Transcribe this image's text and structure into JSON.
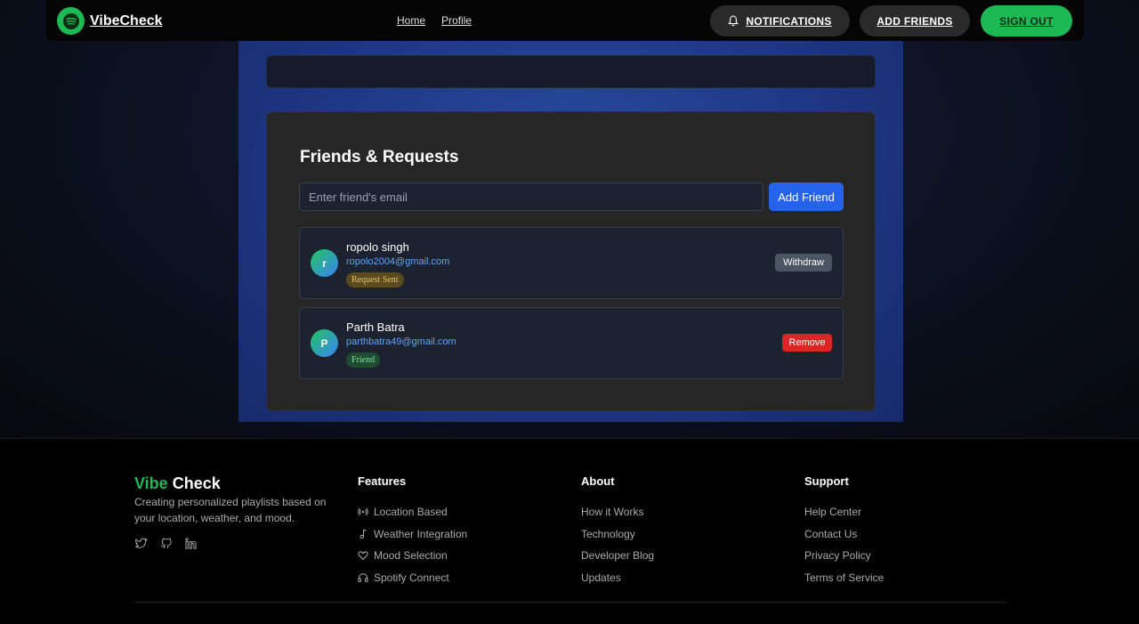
{
  "nav": {
    "brand": "VibeCheck",
    "links": [
      "Home",
      "Profile"
    ],
    "notifications": "NOTIFICATIONS",
    "add_friends": "ADD FRIENDS",
    "sign_out": "SIGN OUT"
  },
  "card": {
    "title": "Friends & Requests",
    "input_placeholder": "Enter friend's email",
    "add_button": "Add Friend"
  },
  "friends": [
    {
      "initial": "r",
      "name": "ropolo singh",
      "email": "ropolo2004@gmail.com",
      "status": "Request Sent",
      "action": "Withdraw"
    },
    {
      "initial": "P",
      "name": "Parth Batra",
      "email": "parthbatra49@gmail.com",
      "status": "Friend",
      "action": "Remove"
    }
  ],
  "footer": {
    "brand_vibe": "Vibe",
    "brand_check": "Check",
    "tagline": "Creating personalized playlists based on your location, weather, and mood.",
    "columns": [
      {
        "title": "Features",
        "items": [
          "Location Based",
          "Weather Integration",
          "Mood Selection",
          "Spotify Connect"
        ]
      },
      {
        "title": "About",
        "items": [
          "How it Works",
          "Technology",
          "Developer Blog",
          "Updates"
        ]
      },
      {
        "title": "Support",
        "items": [
          "Help Center",
          "Contact Us",
          "Privacy Policy",
          "Terms of Service"
        ]
      }
    ]
  },
  "colors": {
    "accent": "#1db954",
    "primary": "#2563eb",
    "danger": "#dc2626"
  }
}
